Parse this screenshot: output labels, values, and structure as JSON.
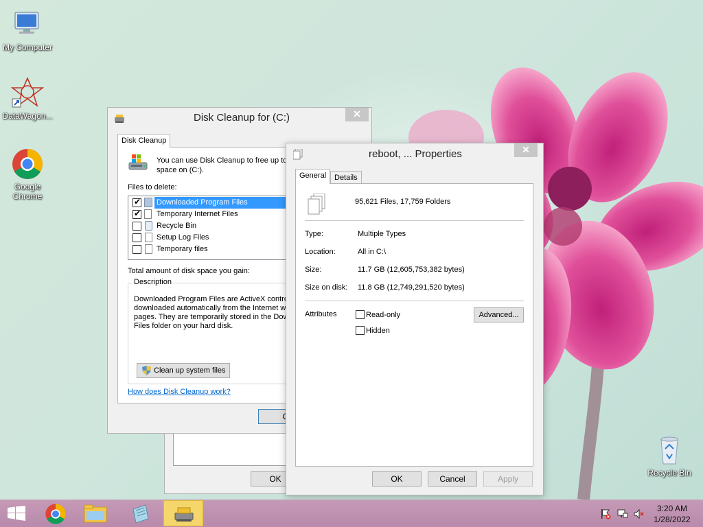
{
  "desktop": {
    "icons": [
      {
        "label": "My Computer"
      },
      {
        "label": "DataWagon..."
      },
      {
        "label": "Google Chrome"
      },
      {
        "label": "Recycle Bin"
      }
    ]
  },
  "disk_cleanup": {
    "title": "Disk Cleanup for  (C:)",
    "tab": "Disk Cleanup",
    "intro": "You can use Disk Cleanup to free up to",
    "intro2": "space on  (C:).",
    "files_label": "Files to delete:",
    "files": [
      {
        "name": "Downloaded Program Files",
        "checked": true,
        "selected": true
      },
      {
        "name": "Temporary Internet Files",
        "checked": true,
        "selected": false
      },
      {
        "name": "Recycle Bin",
        "checked": false,
        "selected": false
      },
      {
        "name": "Setup Log Files",
        "checked": false,
        "selected": false
      },
      {
        "name": "Temporary files",
        "checked": false,
        "selected": false
      }
    ],
    "total_label": "Total amount of disk space you gain:",
    "description_label": "Description",
    "description_lines": [
      "Downloaded Program Files are ActiveX controls",
      "downloaded automatically from the Internet whe",
      "pages. They are temporarily stored in the Down",
      "Files folder on your hard disk."
    ],
    "cleanup_system_button": "Clean up system files",
    "help_link": "How does Disk Cleanup work?",
    "ok_button": "OK",
    "behind_ok_button": "OK"
  },
  "properties": {
    "title": "reboot, ... Properties",
    "tabs": [
      "General",
      "Details"
    ],
    "summary": "95,621 Files, 17,759 Folders",
    "rows": [
      {
        "label": "Type:",
        "value": "Multiple Types"
      },
      {
        "label": "Location:",
        "value": "All in C:\\"
      },
      {
        "label": "Size:",
        "value": "11.7 GB (12,605,753,382 bytes)"
      },
      {
        "label": "Size on disk:",
        "value": "11.8 GB (12,749,291,520 bytes)"
      }
    ],
    "attributes_label": "Attributes",
    "readonly_label": "Read-only",
    "hidden_label": "Hidden",
    "advanced_button": "Advanced...",
    "ok_button": "OK",
    "cancel_button": "Cancel",
    "apply_button": "Apply"
  },
  "taskbar": {
    "time": "3:20 AM",
    "date": "1/28/2022"
  },
  "colors": {
    "selection": "#3399ff",
    "taskbar": "#c49ab6",
    "active_task": "#f5d66a"
  }
}
